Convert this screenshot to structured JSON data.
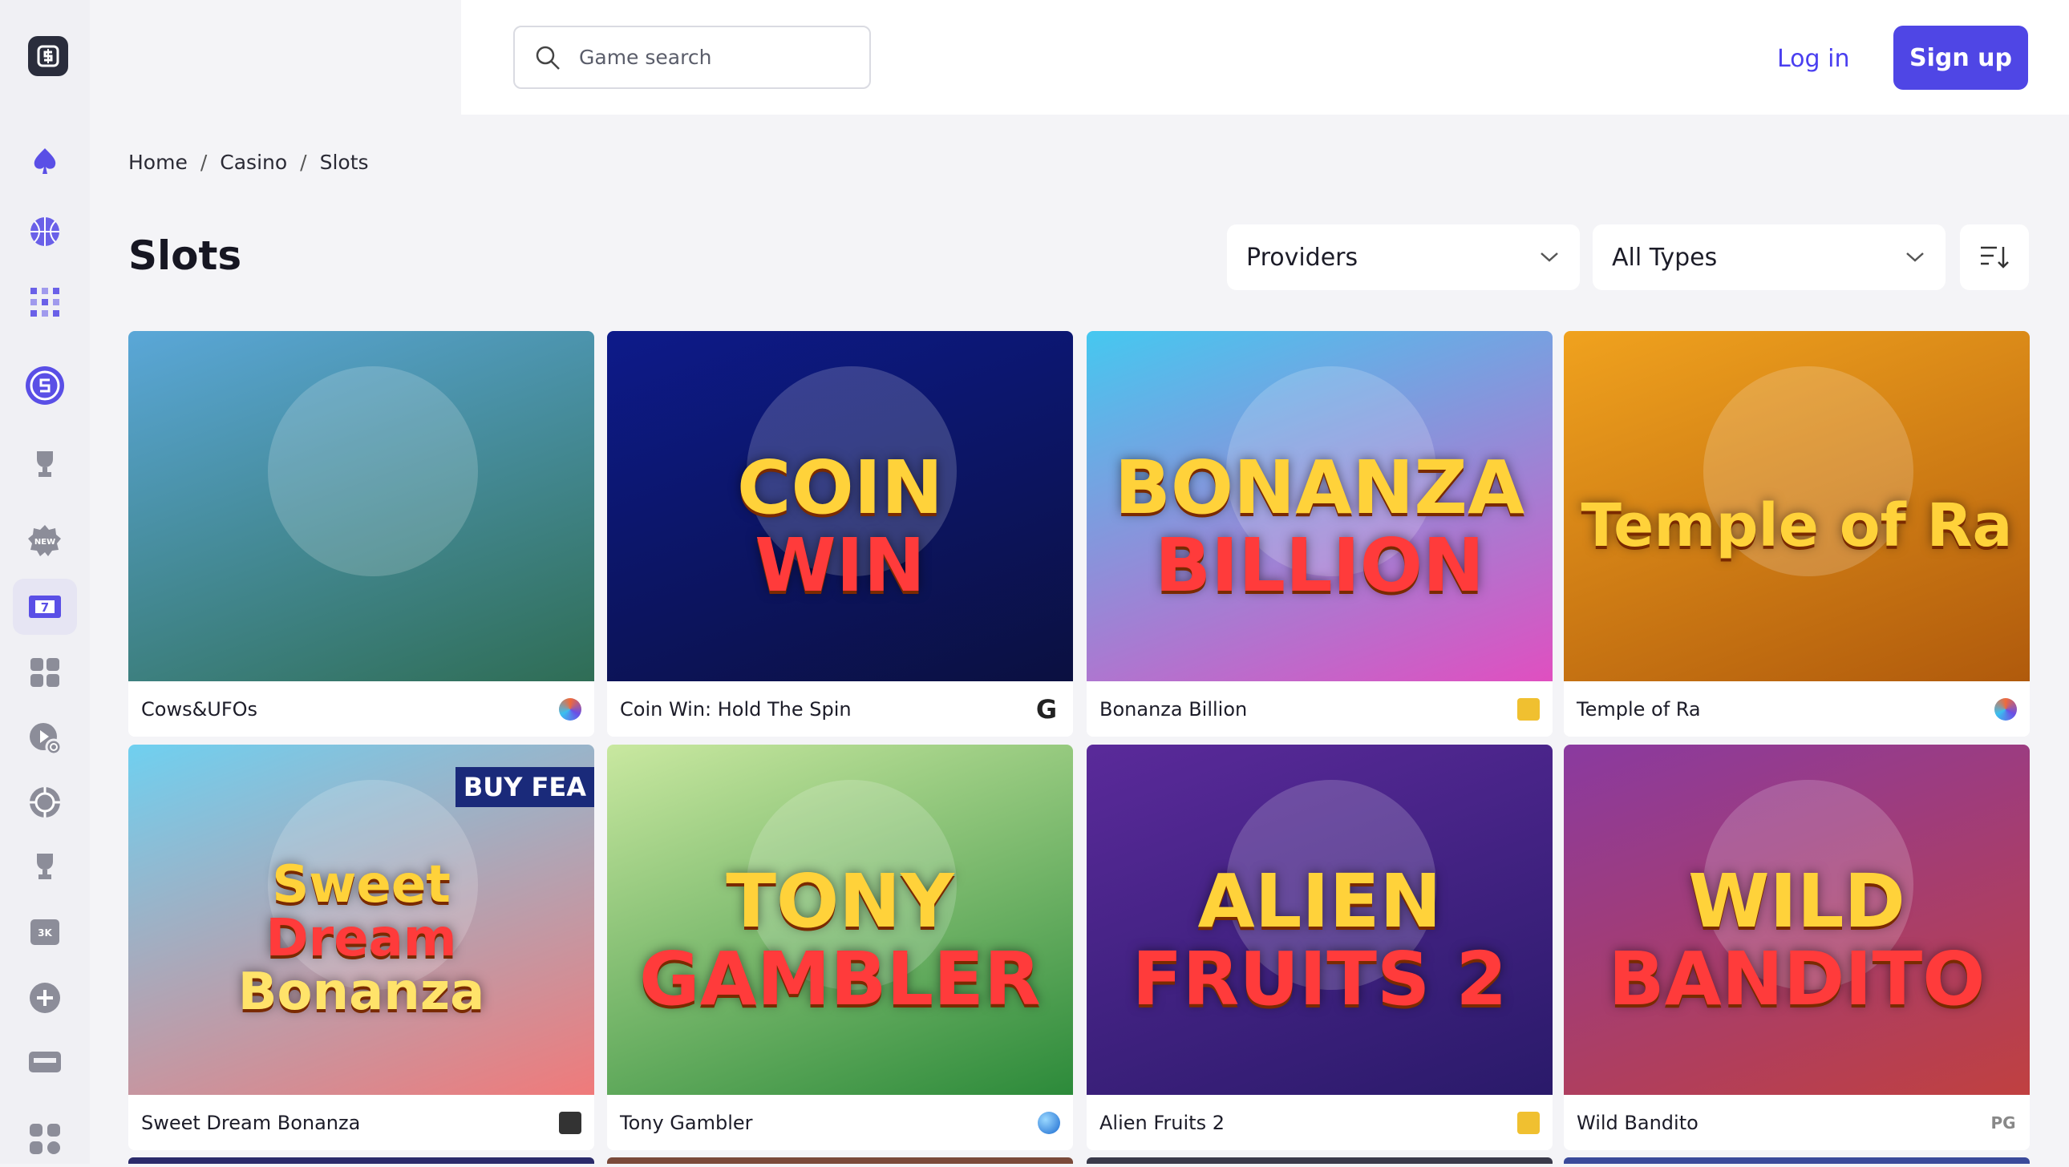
{
  "search": {
    "placeholder": "Game search"
  },
  "auth": {
    "login_label": "Log in",
    "signup_label": "Sign up"
  },
  "breadcrumb": [
    {
      "label": "Home"
    },
    {
      "label": "Casino"
    },
    {
      "label": "Slots"
    }
  ],
  "breadcrumb_sep": "/",
  "page": {
    "title": "Slots"
  },
  "filters": {
    "providers_label": "Providers",
    "types_label": "All Types"
  },
  "sidebar": {
    "items": [
      {
        "icon": "spade-icon"
      },
      {
        "icon": "basketball-icon"
      },
      {
        "icon": "grid-dots-icon"
      },
      {
        "icon": "coin-icon"
      },
      {
        "icon": "trophy-icon"
      },
      {
        "icon": "new-badge-icon"
      },
      {
        "icon": "slot-machine-icon",
        "active": true
      },
      {
        "icon": "apps-grid-icon"
      },
      {
        "icon": "recent-icon"
      },
      {
        "icon": "target-icon"
      },
      {
        "icon": "cup-icon"
      },
      {
        "icon": "tv-icon"
      },
      {
        "icon": "plus-icon"
      },
      {
        "icon": "ticket-icon"
      },
      {
        "icon": "more-apps-icon"
      }
    ]
  },
  "games": [
    {
      "name": "Cows&UFOs",
      "art_colors": [
        "#5aa7d8",
        "#2f6d55"
      ],
      "provider_icon": "swirl-provider-icon"
    },
    {
      "name": "Coin Win: Hold The Spin",
      "art_colors": [
        "#0d1a8a",
        "#0b1040"
      ],
      "art_text": [
        "COIN",
        "WIN"
      ],
      "provider_icon": "G"
    },
    {
      "name": "Bonanza Billion",
      "art_colors": [
        "#45c8f0",
        "#e04fc0"
      ],
      "art_text": [
        "BONANZA",
        "BILLION"
      ],
      "provider_icon": "square-provider-icon"
    },
    {
      "name": "Temple of Ra",
      "art_colors": [
        "#f0a21e",
        "#b05a0c"
      ],
      "art_text": [
        "Temple of Ra"
      ],
      "provider_icon": "swirl-provider-icon"
    },
    {
      "name": "Sweet Dream Bonanza",
      "art_colors": [
        "#6fd0f0",
        "#f07a7a"
      ],
      "art_text": [
        "Sweet",
        "Dream",
        "Bonanza"
      ],
      "badge": "BUY FEA",
      "provider_icon": "grid-provider-icon"
    },
    {
      "name": "Tony Gambler",
      "art_colors": [
        "#c9e8a0",
        "#2c8a3a"
      ],
      "art_text": [
        "TONY",
        "GAMBLER"
      ],
      "provider_icon": "globe-provider-icon"
    },
    {
      "name": "Alien Fruits 2",
      "art_colors": [
        "#5a2a9a",
        "#2a1a6a"
      ],
      "art_text": [
        "ALIEN",
        "FRUITS 2"
      ],
      "provider_icon": "square-provider-icon"
    },
    {
      "name": "Wild Bandito",
      "art_colors": [
        "#8a3aa0",
        "#c04040"
      ],
      "art_text": [
        "WILD",
        "BANDITO"
      ],
      "provider_icon": "PG"
    }
  ]
}
